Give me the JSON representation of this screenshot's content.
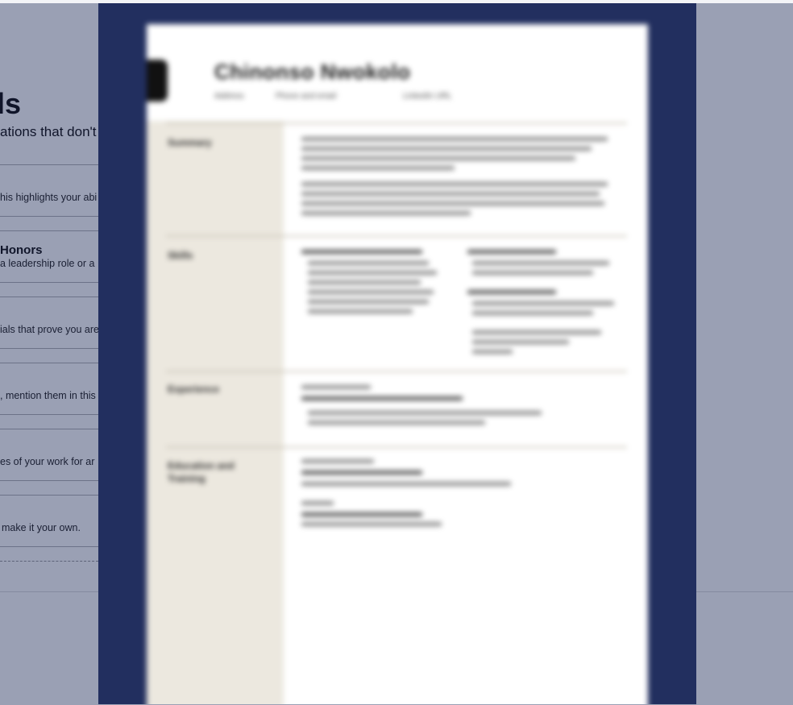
{
  "background": {
    "heading_fragment": "ls",
    "subheading_fragment": "ations that don't",
    "rows": [
      {
        "title": "",
        "text": "his highlights your abi"
      },
      {
        "title": "Honors",
        "text": "a leadership role or a"
      },
      {
        "title": "",
        "text": "ials that prove you are"
      },
      {
        "title": "",
        "text": ", mention them in this"
      },
      {
        "title": "",
        "text": "es of your work for ar"
      }
    ],
    "last_text": "make it your own."
  },
  "preview": {
    "name": "Chinonso Nwokolo",
    "contact": [
      "Address",
      "Phone and email",
      "LinkedIn URL"
    ],
    "sections": [
      "Summary",
      "Skills",
      "Experience",
      "Education and Training"
    ]
  },
  "colors": {
    "overlay": "#9aa0b4",
    "modal": "#222f5f",
    "sidebar": "#ece8df",
    "paper": "#ffffff"
  }
}
